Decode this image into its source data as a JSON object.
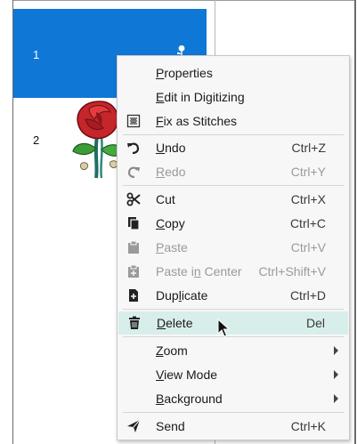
{
  "rows": [
    {
      "number": "1",
      "selected": true
    },
    {
      "number": "2",
      "selected": false
    }
  ],
  "context_menu": {
    "items": [
      {
        "label": "Properties",
        "shortcut": "",
        "icon": "none",
        "enabled": true
      },
      {
        "label": "Edit in Digitizing",
        "shortcut": "",
        "icon": "none",
        "enabled": true
      },
      {
        "label": "Fix as Stitches",
        "shortcut": "",
        "icon": "fix-stitches-icon",
        "enabled": true
      },
      {
        "label": "Undo",
        "shortcut": "Ctrl+Z",
        "icon": "undo-icon",
        "enabled": true
      },
      {
        "label": "Redo",
        "shortcut": "Ctrl+Y",
        "icon": "redo-icon",
        "enabled": false
      },
      {
        "label": "Cut",
        "shortcut": "Ctrl+X",
        "icon": "scissors-icon",
        "enabled": true
      },
      {
        "label": "Copy",
        "shortcut": "Ctrl+C",
        "icon": "copy-icon",
        "enabled": true
      },
      {
        "label": "Paste",
        "shortcut": "Ctrl+V",
        "icon": "paste-icon",
        "enabled": false
      },
      {
        "label": "Paste in Center",
        "shortcut": "Ctrl+Shift+V",
        "icon": "paste-center-icon",
        "enabled": false
      },
      {
        "label": "Duplicate",
        "shortcut": "Ctrl+D",
        "icon": "duplicate-icon",
        "enabled": true
      },
      {
        "label": "Delete",
        "shortcut": "Del",
        "icon": "trash-icon",
        "enabled": true,
        "highlighted": true
      },
      {
        "label": "Zoom",
        "shortcut": "",
        "icon": "none",
        "enabled": true,
        "submenu": true
      },
      {
        "label": "View Mode",
        "shortcut": "",
        "icon": "none",
        "enabled": true,
        "submenu": true
      },
      {
        "label": "Background",
        "shortcut": "",
        "icon": "none",
        "enabled": true,
        "submenu": true
      },
      {
        "label": "Send",
        "shortcut": "Ctrl+K",
        "icon": "send-icon",
        "enabled": true
      }
    ]
  },
  "colors": {
    "selection": "#0f78d7",
    "menu_bg": "#f7f7f7",
    "hover": "#d8eeea"
  }
}
